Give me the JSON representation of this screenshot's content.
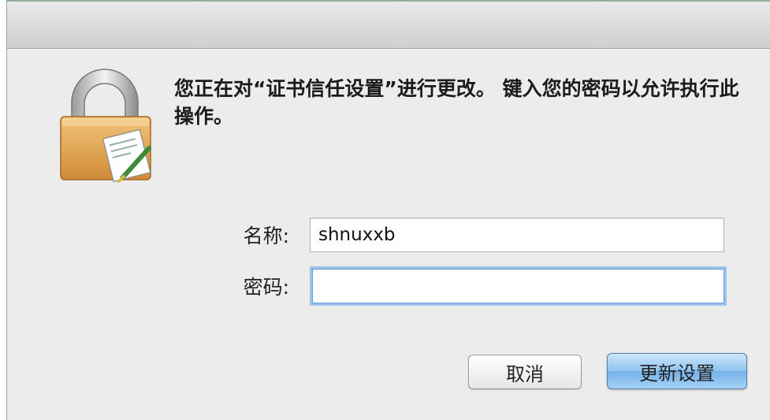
{
  "dialog": {
    "message": "您正在对“证书信任设置”进行更改。 键入您的密码以允许执行此操作。"
  },
  "form": {
    "name_label": "名称:",
    "name_value": "shnuxxb",
    "password_label": "密码:",
    "password_value": ""
  },
  "buttons": {
    "cancel_label": "取消",
    "update_label": "更新设置"
  },
  "colors": {
    "window_bg": "#ececec",
    "default_button": "#8ec3ef",
    "focus_ring": "#9cc3ee"
  },
  "icons": {
    "dialog_icon": "lock-with-document-icon"
  }
}
